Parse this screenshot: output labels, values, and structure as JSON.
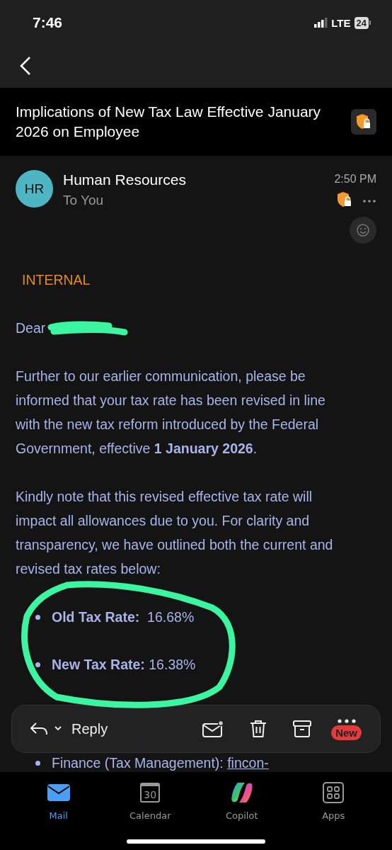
{
  "status_bar": {
    "time": "7:46",
    "network": "LTE",
    "battery": "24"
  },
  "subject": "Implications of New Tax Law Effective January 2026 on Employee",
  "sender": {
    "initials": "HR",
    "name": "Human Resources",
    "recipient": "To You",
    "time": "2:50 PM"
  },
  "body": {
    "label": "INTERNAL",
    "greeting": "Dear",
    "paragraphs": [
      "Further to our earlier communication, please be informed that your tax rate has been revised in line with the new tax reform introduced by the Federal Government, effective **1 January 2026**.",
      "Kindly note that this revised effective tax rate will impact all allowances due to you. For clarity and transparency, we have outlined both the current and revised tax rates below:"
    ],
    "rates": [
      "**Old Tax Rate:**  16.68%",
      "**New Tax Rate:** 16.38%"
    ],
    "contacts": [
      {
        "text": "Finance (Tax Management):",
        "link": "fincon-"
      }
    ]
  },
  "annotations": {
    "redaction_scribble": true,
    "circle_around_rates": true
  },
  "action_bar": {
    "reply": "Reply",
    "badge": "New"
  },
  "tabs": [
    {
      "kind": "mail",
      "label": "Mail",
      "selected": true
    },
    {
      "kind": "calendar",
      "label": "Calendar",
      "icon_text": "30",
      "selected": false
    },
    {
      "kind": "copilot",
      "label": "Copilot",
      "selected": false
    },
    {
      "kind": "apps",
      "label": "Apps",
      "selected": false
    }
  ]
}
